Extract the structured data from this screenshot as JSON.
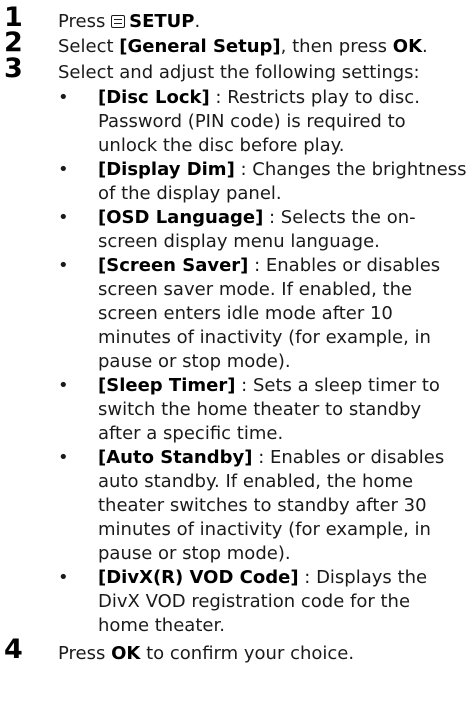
{
  "steps": [
    {
      "num": "1",
      "pre": "Press ",
      "icon": "setup-menu-icon",
      "bold": "SETUP",
      "post": "."
    },
    {
      "num": "2",
      "pre": "Select ",
      "bold1": "[General Setup]",
      "mid": ", then press ",
      "bold2": "OK",
      "post": "."
    },
    {
      "num": "3",
      "text": "Select and adjust the following settings:"
    },
    {
      "num": "4",
      "pre": "Press ",
      "bold": "OK",
      "post": " to confirm your choice."
    }
  ],
  "bullet_symbol": "•",
  "settings": [
    {
      "name": "[Disc Lock]",
      "desc": [
        " : Restricts play to disc.",
        "Password (PIN code) is required to",
        "unlock the disc before play."
      ]
    },
    {
      "name": "[Display Dim]",
      "desc": [
        " : Changes the brightness",
        "of the display panel."
      ]
    },
    {
      "name": "[OSD Language]",
      "desc": [
        " : Selects the on-",
        "screen display menu language."
      ]
    },
    {
      "name": "[Screen Saver]",
      "desc": [
        " : Enables or disables",
        "screen saver mode. If enabled, the",
        "screen enters idle mode after 10",
        "minutes of inactivity (for example, in",
        "pause or stop mode)."
      ]
    },
    {
      "name": "[Sleep Timer]",
      "desc": [
        " : Sets a sleep timer to",
        "switch the home theater to standby",
        "after a specific time."
      ]
    },
    {
      "name": "[Auto Standby]",
      "desc": [
        " : Enables or disables",
        "auto standby. If enabled, the home",
        "theater switches to standby after 30",
        "minutes of inactivity (for example, in",
        "pause or stop mode)."
      ]
    },
    {
      "name": "[DivX(R) VOD Code]",
      "desc": [
        " : Displays the",
        "DivX VOD registration code for the",
        "home theater."
      ]
    }
  ]
}
